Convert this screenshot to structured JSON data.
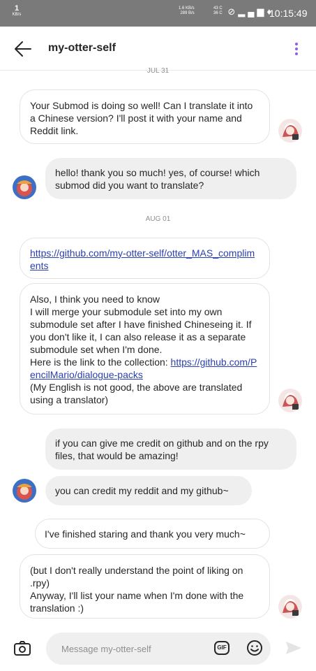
{
  "status_bar": {
    "speed_value": "1",
    "speed_unit": "KB/s",
    "net_up": "1.6 KB/s",
    "net_down": "289 B/s",
    "temp_top": "43 C",
    "temp_bottom": "36 C",
    "time": "10:15:49"
  },
  "header": {
    "title": "my-otter-self"
  },
  "conversation": {
    "date_labels": [
      "JUL 31",
      "AUG 01"
    ],
    "messages": [
      {
        "text": "Your Submod is doing so well! Can I translate it into a Chinese version? I'll post it with your name and Reddit link."
      },
      {
        "text": "hello! thank you so much! yes, of course! which submod did you want to translate?"
      },
      {
        "link": "https://github.com/my-otter-self/otter_MAS_compliments"
      },
      {
        "text": "Also, I think you need to know\nI will merge your submodule set into my own submodule set after I have finished Chineseing it. If you don't like it, I can also release it as a separate submodule set when I'm done.\nHere is the link to the collection: ",
        "link": "https://github.com/PencilMario/dialogue-packs",
        "text_after": "\n(My English is not good, the above are translated using a translator)"
      },
      {
        "text": "if you can give me credit on github and on the rpy files, that would be amazing!"
      },
      {
        "text": "you can credit my reddit and my github~"
      },
      {
        "text": "I've finished staring and thank you very much~"
      },
      {
        "text": "(but I don't really understand the point of liking on .rpy)\nAnyway, I'll list your name when I'm done with the translation :)"
      }
    ]
  },
  "composer": {
    "placeholder": "Message my-otter-self",
    "gif_label": "GIF"
  },
  "colors": {
    "accent": "#8e5cf0",
    "link": "#2a3fb0",
    "incoming_bubble": "#efefef",
    "outgoing_border": "#e3e3e3",
    "statusbar": "#7a7a7a"
  },
  "icons": [
    "back-arrow-icon",
    "more-vertical-icon",
    "camera-icon",
    "gif-icon",
    "emoji-icon",
    "send-icon"
  ]
}
